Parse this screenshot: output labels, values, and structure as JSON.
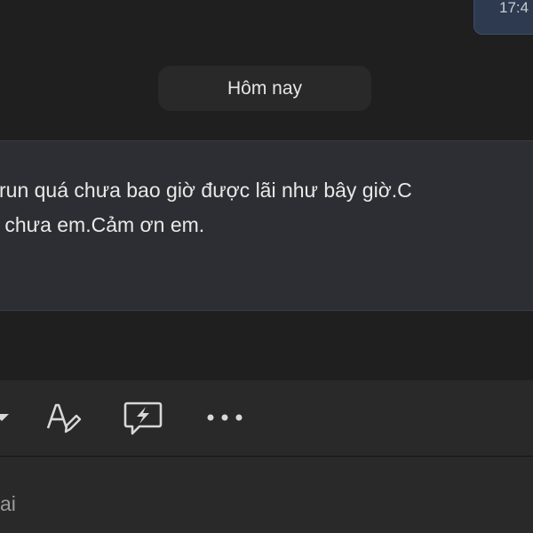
{
  "sent_message": {
    "time_partial": "17:4"
  },
  "date_separator": {
    "label": "Hôm nay"
  },
  "message": {
    "lines": [
      "run quá chưa bao giờ được lãi như bây giờ.C",
      " chưa em.Cảm ơn em."
    ]
  },
  "compose": {
    "toolbar_icons": [
      "chevron-down-icon",
      "format-text-icon",
      "loop-component-icon",
      "more-options-icon"
    ],
    "placeholder_partial": "ai"
  },
  "colors": {
    "background": "#1f1f1f",
    "card": "#2c2e33",
    "compose": "#292929",
    "sent_bubble": "#2d3a4f"
  }
}
